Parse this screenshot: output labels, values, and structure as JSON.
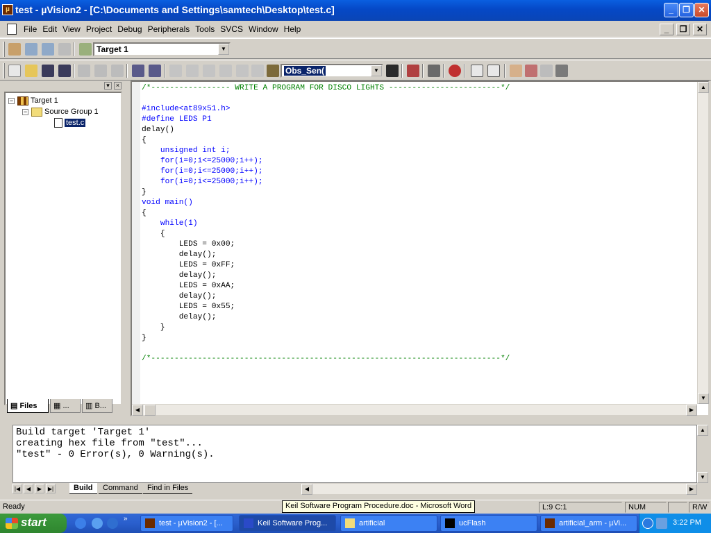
{
  "window": {
    "title": "test  - µVision2 - [C:\\Documents and Settings\\samtech\\Desktop\\test.c]",
    "app_icon": "uvision-icon"
  },
  "menu": [
    "File",
    "Edit",
    "View",
    "Project",
    "Debug",
    "Peripherals",
    "Tools",
    "SVCS",
    "Window",
    "Help"
  ],
  "toolbar1": {
    "target_select": "Target 1"
  },
  "toolbar2": {
    "find_combo": "Obs_Sen("
  },
  "project": {
    "tree": [
      {
        "label": "Target 1",
        "expander": "−",
        "icon": "target-icon"
      },
      {
        "label": "Source Group 1",
        "expander": "−",
        "icon": "folder-icon"
      },
      {
        "label": "test.c",
        "icon": "file-icon"
      }
    ],
    "tabs": [
      "Files",
      "...",
      "B..."
    ]
  },
  "editor": {
    "lines": [
      "/*----------------- WRITE A PROGRAM FOR DISCO LIGHTS ------------------------*/",
      "",
      "#include<at89x51.h>",
      "#define LEDS P1",
      "delay()",
      "{",
      "    unsigned int i;",
      "    for(i=0;i<=25000;i++);",
      "    for(i=0;i<=25000;i++);",
      "    for(i=0;i<=25000;i++);",
      "}",
      "void main()",
      "{",
      "    while(1)",
      "    {",
      "        LEDS = 0x00;",
      "        delay();",
      "        LEDS = 0xFF;",
      "        delay();",
      "        LEDS = 0xAA;",
      "        delay();",
      "        LEDS = 0x55;",
      "        delay();",
      "    }",
      "}",
      "",
      "/*---------------------------------------------------------------------------*/"
    ]
  },
  "output": {
    "lines": [
      "Build target 'Target 1'",
      "creating hex file from \"test\"...",
      "\"test\" - 0 Error(s), 0 Warning(s)."
    ],
    "tabs": [
      "Build",
      "Command",
      "Find in Files"
    ]
  },
  "status": {
    "ready": "Ready",
    "tooltip": "Keil Software Program Procedure.doc - Microsoft Word",
    "position": "L:9 C:1",
    "num": "NUM",
    "rw": "R/W"
  },
  "taskbar": {
    "start": "start",
    "tasks": [
      {
        "label": "test  - µVision2 - [...",
        "active": false
      },
      {
        "label": "Keil Software Prog...",
        "active": true
      },
      {
        "label": "artificial",
        "active": false
      },
      {
        "label": "ucFlash",
        "active": false
      },
      {
        "label": "artificial_arm  - µVi...",
        "active": false
      }
    ],
    "clock": "3:22 PM"
  }
}
